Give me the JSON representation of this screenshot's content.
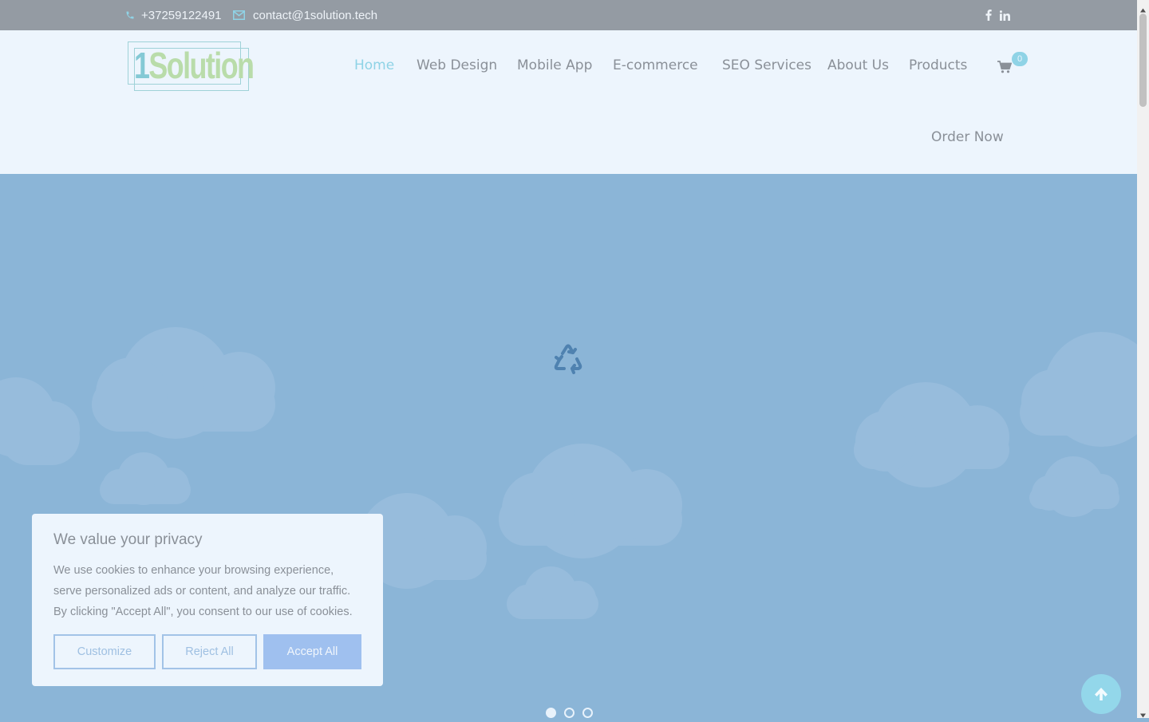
{
  "topbar": {
    "phone": "+37259122491",
    "email": "contact@1solution.tech",
    "icons": [
      "phone-icon",
      "envelope-icon",
      "facebook-icon",
      "linkedin-icon"
    ]
  },
  "header": {
    "logo_text_a": "1",
    "logo_text_b": "Solution",
    "nav": [
      {
        "label": "Home",
        "active": true
      },
      {
        "label": "Web Design"
      },
      {
        "label": "Mobile App"
      },
      {
        "label": "E-commerce"
      },
      {
        "label": "SEO Services"
      },
      {
        "label": "About Us"
      },
      {
        "label": "Products"
      }
    ],
    "cart_count": "0",
    "order_label": "Order Now"
  },
  "hero": {
    "loader_icon": "recycle-icon",
    "slides": 3,
    "active_slide": 1
  },
  "cookie": {
    "title": "We value your privacy",
    "text": "We use cookies to enhance your browsing experience, serve personalized ads or content, and analyze our traffic. By clicking \"Accept All\", you consent to our use of cookies.",
    "customize": "Customize",
    "reject": "Reject All",
    "accept": "Accept All"
  },
  "colors": {
    "accent": "#8fd3e6",
    "hero_bg": "#8bb5d7",
    "header_bg": "#edf5fd",
    "topbar_bg": "#949ba3",
    "button_fill": "#9fc0ef"
  }
}
